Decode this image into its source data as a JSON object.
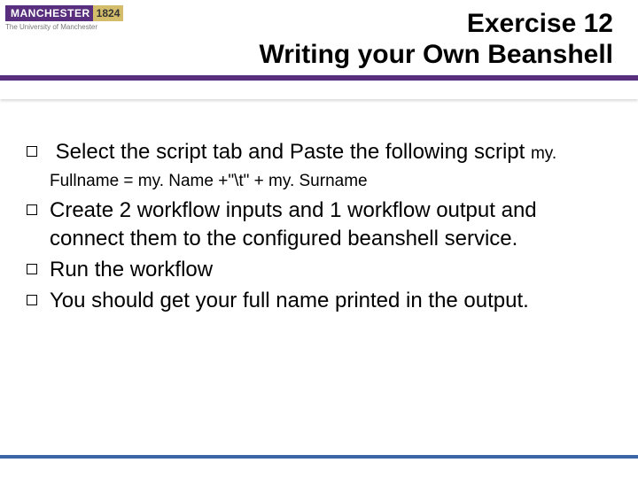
{
  "logo": {
    "name": "MANCHESTER",
    "year": "1824",
    "subtitle": "The University of Manchester"
  },
  "title": {
    "line1": "Exercise 12",
    "line2": "Writing your Own Beanshell"
  },
  "bullets": [
    {
      "text": "Select the script tab and Paste the following script",
      "code": "my. Fullname = my. Name +\"\\t\" + my. Surname"
    },
    {
      "text": "Create 2 workflow inputs and 1 workflow output and connect them to the configured beanshell service."
    },
    {
      "text": "Run the workflow"
    },
    {
      "text": "You should get your full name printed in the output."
    }
  ]
}
